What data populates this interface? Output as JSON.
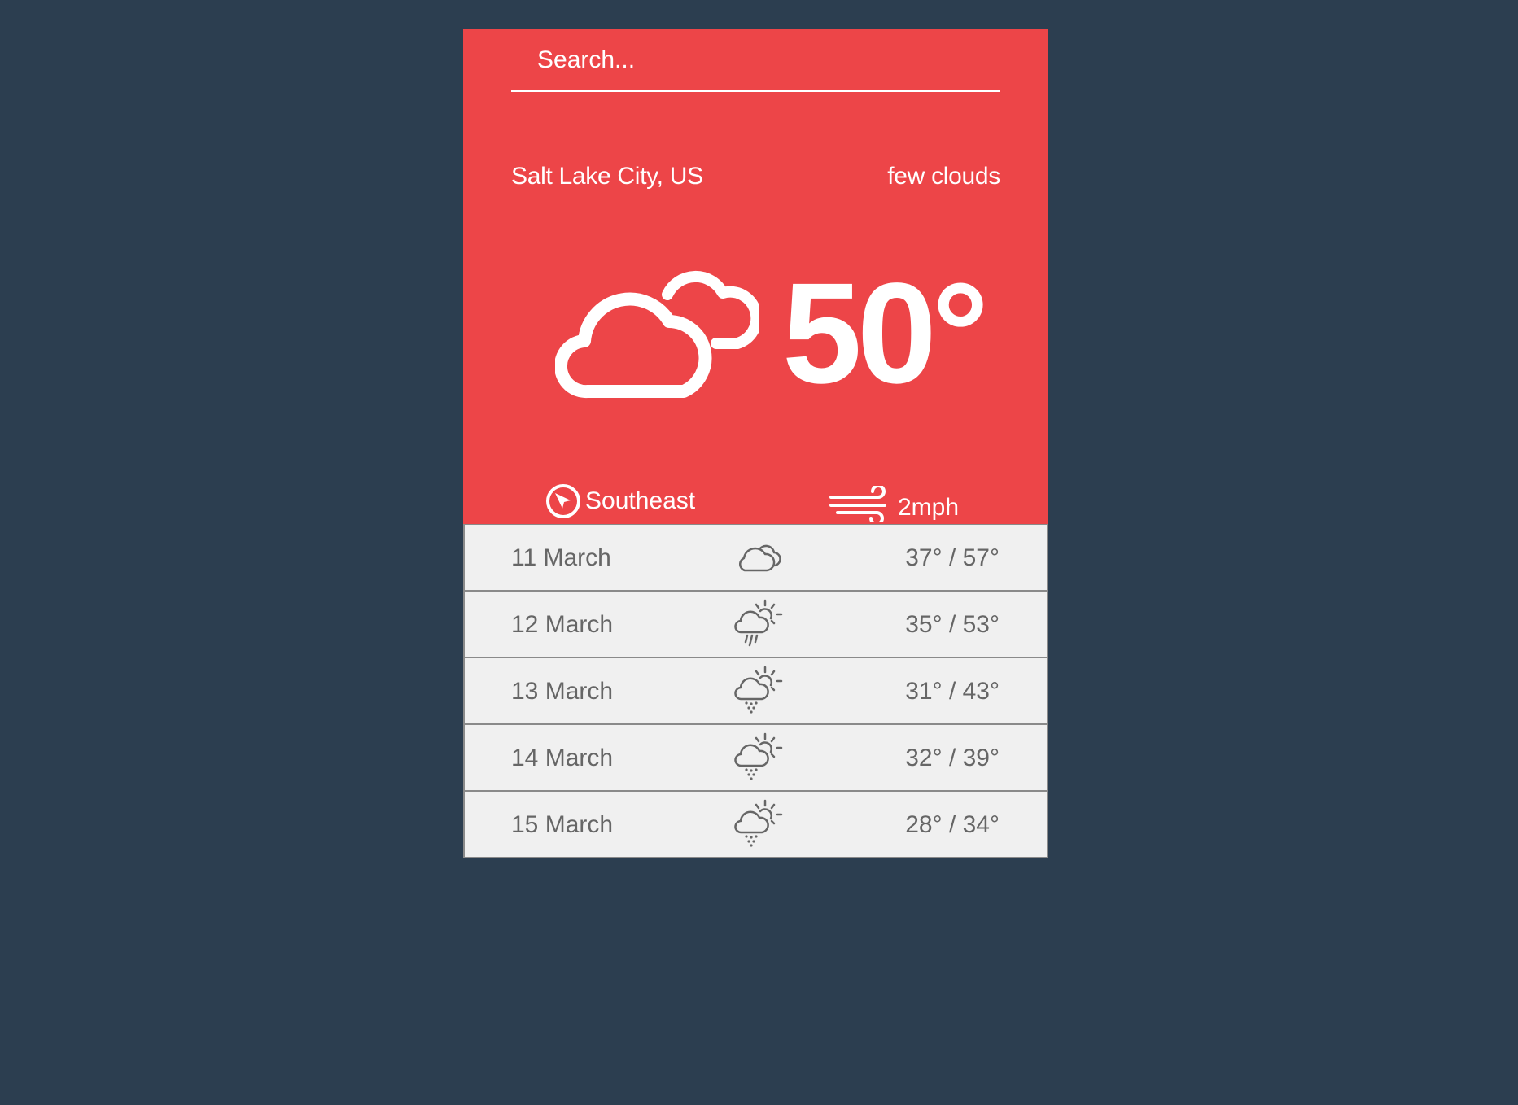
{
  "search": {
    "placeholder": "Search..."
  },
  "current": {
    "location": "Salt Lake City, US",
    "description": "few clouds",
    "temperature": "50°",
    "icon": "few-clouds-icon",
    "wind_direction": "Southeast",
    "wind_speed": "2mph"
  },
  "forecast": [
    {
      "date": "11 March",
      "icon": "cloudy-icon",
      "temps": "37° / 57°"
    },
    {
      "date": "12 March",
      "icon": "rain-sun-icon",
      "temps": "35° / 53°"
    },
    {
      "date": "13 March",
      "icon": "snow-sun-icon",
      "temps": "31° / 43°"
    },
    {
      "date": "14 March",
      "icon": "snow-sun-icon",
      "temps": "32° / 39°"
    },
    {
      "date": "15 March",
      "icon": "snow-sun-icon",
      "temps": "28° / 34°"
    }
  ],
  "colors": {
    "background": "#2c3e50",
    "accent": "#ed4548",
    "forecast_bg": "#f0f0f0",
    "forecast_text": "#666666"
  }
}
